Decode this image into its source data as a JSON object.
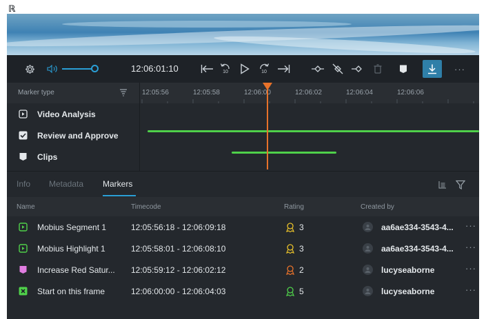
{
  "corner_glyph": "ℝ",
  "player": {
    "timecode": "12:06:01:10",
    "skip_back_label": "10",
    "skip_fwd_label": "10",
    "more_label": "···"
  },
  "timeline": {
    "marker_type_label": "Marker type",
    "ticks": [
      "12:05:56",
      "12:05:58",
      "12:06:00",
      "12:06:02",
      "12:06:04",
      "12:06:06"
    ],
    "tracks": [
      {
        "label": "Video Analysis",
        "color": "#4fd14a"
      },
      {
        "label": "Review and Approve",
        "color": "#4fd14a"
      },
      {
        "label": "Clips",
        "color": "#e07de0"
      }
    ]
  },
  "tabs": [
    {
      "label": "Info"
    },
    {
      "label": "Metadata"
    },
    {
      "label": "Markers"
    }
  ],
  "list": {
    "headers": {
      "name": "Name",
      "timecode": "Timecode",
      "rating": "Rating",
      "created_by": "Created by"
    },
    "rows": [
      {
        "name": "Mobius Segment 1",
        "timecode": "12:05:56:18 - 12:06:09:18",
        "rating": "3",
        "rating_color": "#e8c02a",
        "created_by": "aa6ae334-3543-4...",
        "icon": "play-square-icon",
        "icon_color": "#4fd14a",
        "more": "···"
      },
      {
        "name": "Mobius Highlight 1",
        "timecode": "12:05:58:01 - 12:06:08:10",
        "rating": "3",
        "rating_color": "#e8c02a",
        "created_by": "aa6ae334-3543-4...",
        "icon": "play-square-icon",
        "icon_color": "#4fd14a",
        "more": "···"
      },
      {
        "name": "Increase Red Satur...",
        "timecode": "12:05:59:12 - 12:06:02:12",
        "rating": "2",
        "rating_color": "#e8722a",
        "created_by": "lucyseaborne",
        "icon": "clip-icon",
        "icon_color": "#e07de0",
        "more": "···"
      },
      {
        "name": "Start on this frame",
        "timecode": "12:06:00:00 - 12:06:04:03",
        "rating": "5",
        "rating_color": "#4fd14a",
        "created_by": "lucyseaborne",
        "icon": "reject-square-icon",
        "icon_color": "#4fd14a",
        "more": "···"
      }
    ]
  },
  "colors": {
    "accent": "#2a9fd6",
    "playhead": "#e8722a"
  }
}
